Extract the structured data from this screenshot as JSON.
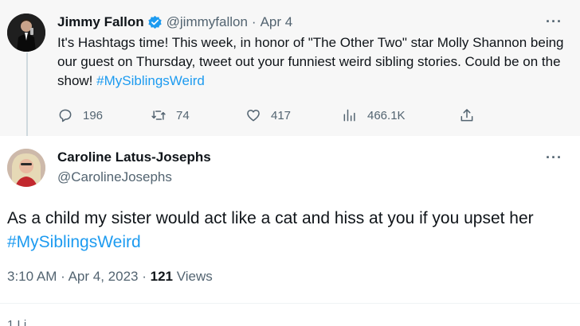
{
  "parent_tweet": {
    "author_name": "Jimmy Fallon",
    "handle": "@jimmyfallon",
    "separator": "·",
    "date": "Apr 4",
    "more_icon": "···",
    "text_plain": "It's Hashtags time! This week, in honor of \"The Other Two\" star Molly Shannon being our guest on Thursday, tweet out your funniest weird sibling stories. Could be on the show! ",
    "hashtag": "#MySiblingsWeird",
    "actions": {
      "replies": "196",
      "retweets": "74",
      "likes": "417",
      "views": "466.1K"
    }
  },
  "reply_tweet": {
    "author_name": "Caroline Latus-Josephs",
    "handle": "@CarolineJosephs",
    "more_icon": "···",
    "text_plain": "As a child my sister would act like a cat and hiss at you if you upset her ",
    "hashtag": "#MySiblingsWeird",
    "time": "3:10 AM",
    "separator": "·",
    "date": "Apr 4, 2023",
    "views_count": "121",
    "views_label": "Views",
    "partial_stat": "1 Li"
  },
  "colors": {
    "link": "#1d9bf0",
    "secondary_text": "#536471",
    "verified": "#1d9bf0",
    "parent_bg": "#f7f7f7"
  }
}
